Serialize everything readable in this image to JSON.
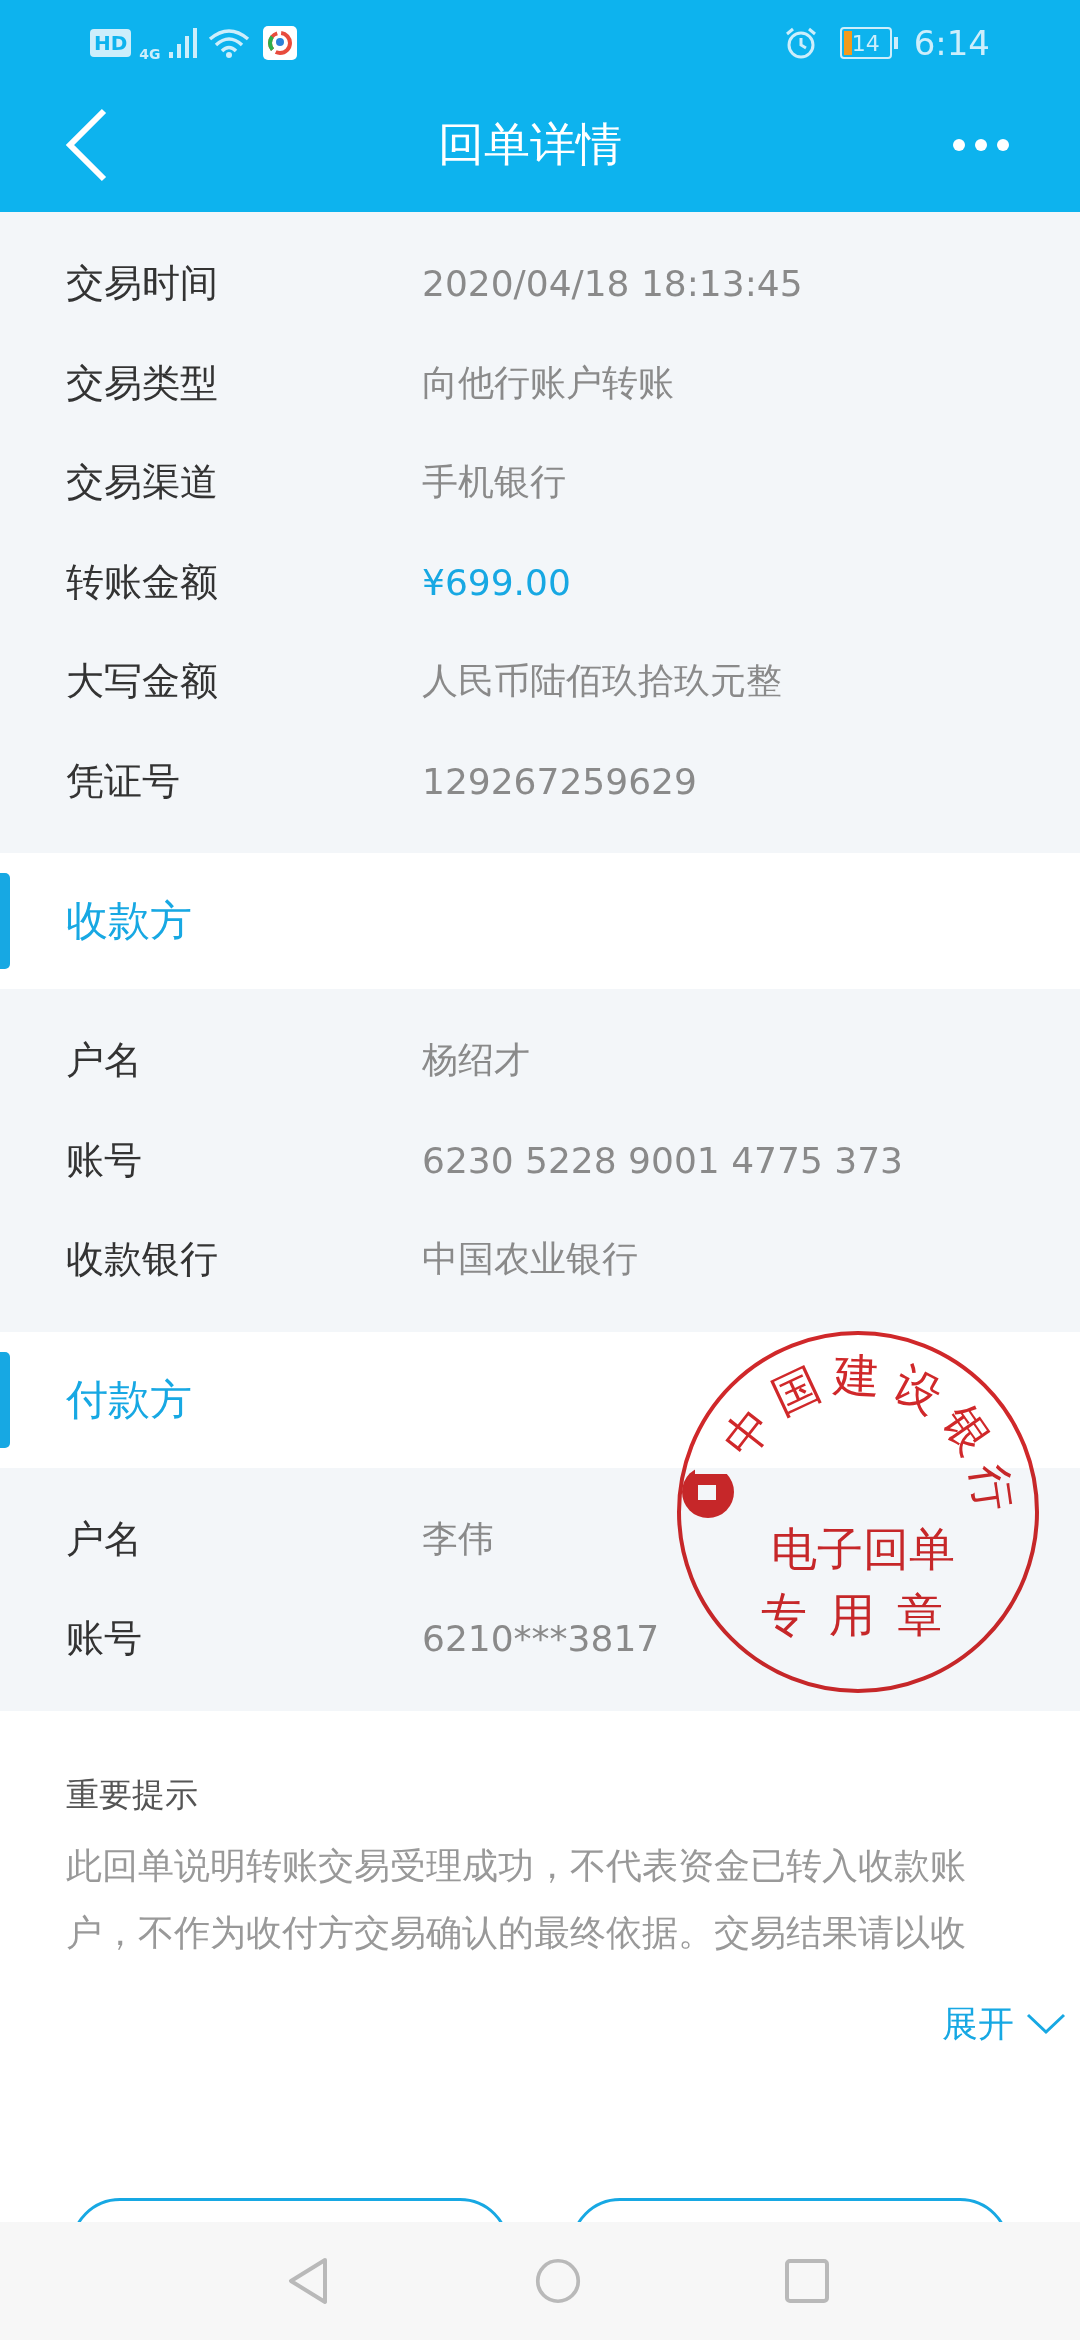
{
  "status_bar": {
    "hd_badge": "HD",
    "network": "4G",
    "battery": "14",
    "time": "6:14"
  },
  "header": {
    "title": "回单详情"
  },
  "transaction": [
    {
      "label": "交易时间",
      "value": "2020/04/18  18:13:45",
      "emphasized": false
    },
    {
      "label": "交易类型",
      "value": "向他行账户转账",
      "emphasized": false
    },
    {
      "label": "交易渠道",
      "value": "手机银行",
      "emphasized": false
    },
    {
      "label": "转账金额",
      "value": "¥699.00",
      "emphasized": true
    },
    {
      "label": "大写金额",
      "value": "人民币陆佰玖拾玖元整",
      "emphasized": false
    },
    {
      "label": "凭证号",
      "value": "129267259629",
      "emphasized": false
    }
  ],
  "sections": [
    {
      "title": "收款方",
      "rows": [
        {
          "label": "户名",
          "value": "杨绍才"
        },
        {
          "label": "账号",
          "value": "6230 5228 9001 4775 373"
        },
        {
          "label": "收款银行",
          "value": "中国农业银行"
        }
      ]
    },
    {
      "title": "付款方",
      "rows": [
        {
          "label": "户名",
          "value": "李伟"
        },
        {
          "label": "账号",
          "value": "6210***3817"
        }
      ]
    }
  ],
  "stamp": {
    "arc_text": "中国建设银行",
    "lines": [
      "电子回单",
      "专用章"
    ]
  },
  "notice": {
    "title": "重要提示",
    "text": "此回单说明转账交易受理成功，不代表资金已转入收款账户，不作为收付方交易确认的最终依据。交易结果请以收",
    "expand_label": "展开"
  }
}
